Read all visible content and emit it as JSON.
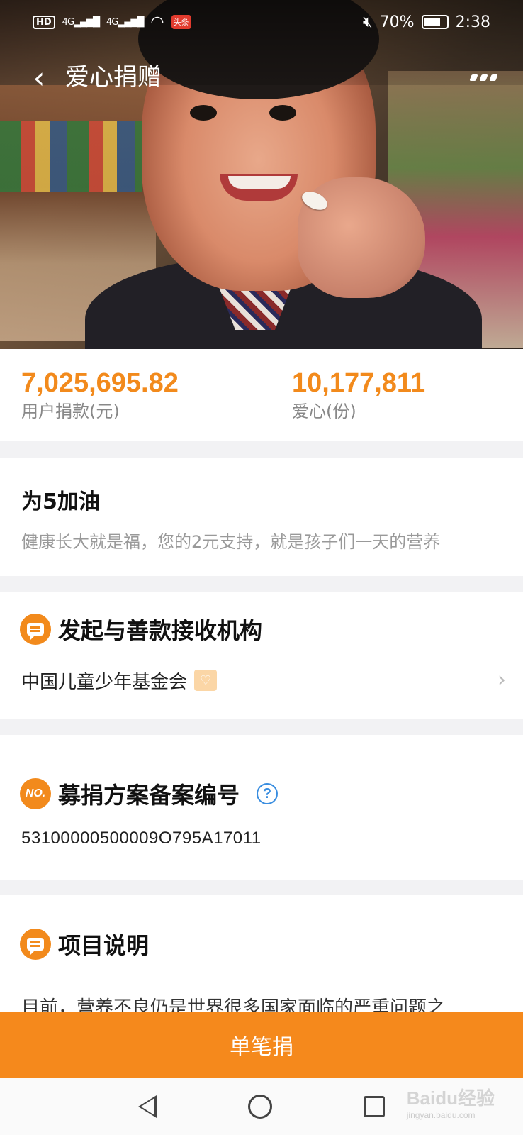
{
  "status_bar": {
    "hd": "HD",
    "signal_1": "4G",
    "signal_2": "4G",
    "news_badge": "头条",
    "battery_pct": "70%",
    "time": "2:38"
  },
  "header": {
    "back_icon": "back-arrow-icon",
    "title": "爱心捐赠",
    "more_icon": "more-dots-icon"
  },
  "hero": {
    "image": "child-photo"
  },
  "stats": {
    "donation_amount": "7,025,695.82",
    "donation_label": "用户捐款(元)",
    "hearts_count": "10,177,811",
    "hearts_label": "爱心(份)"
  },
  "cheer": {
    "title": "为5加油",
    "description": "健康长大就是福，您的2元支持，就是孩子们一天的营养"
  },
  "organization": {
    "section_title": "发起与善款接收机构",
    "name": "中国儿童少年基金会"
  },
  "filing": {
    "icon_text": "NO.",
    "section_title": "募捐方案备案编号",
    "help_icon": "?",
    "number": "53100000500009O795A17011"
  },
  "project": {
    "section_title": "项目说明",
    "text": "目前，营养不良仍是世界很多国家面临的严重问题之"
  },
  "donate_button": {
    "label": "单笔捐"
  },
  "watermark": {
    "text": "Baidu经验",
    "sub": "jingyan.baidu.com"
  },
  "colors": {
    "accent": "#f28a1c",
    "donate_bar": "#f5891c",
    "help_blue": "#3a8ee0"
  }
}
